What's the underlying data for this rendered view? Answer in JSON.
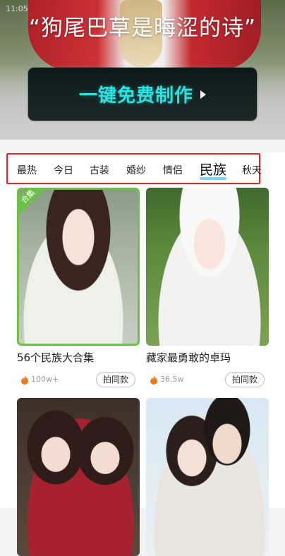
{
  "status": {
    "time": "11:05"
  },
  "hero": {
    "title": "“狗尾巴草是晦涩的诗”",
    "cta_label": "一键免费制作"
  },
  "tabs": {
    "items": [
      "最热",
      "今日",
      "古装",
      "婚纱",
      "情侣",
      "民族",
      "秋天"
    ],
    "active": "民族",
    "highlight_color": "#e0252b",
    "underline_color": "#7fd5f0"
  },
  "cards": [
    {
      "title": "56个民族大合集",
      "heat": "100w+",
      "action": "拍同款",
      "badge": "合集",
      "selected": true
    },
    {
      "title": "藏家最勇敢的卓玛",
      "heat": "36.5w",
      "action": "拍同款",
      "badge": "",
      "selected": false
    },
    {
      "title": "",
      "heat": "",
      "action": "",
      "badge": "",
      "selected": false
    },
    {
      "title": "",
      "heat": "",
      "action": "",
      "badge": "",
      "selected": false
    }
  ],
  "colors": {
    "cta_text": "#2de3e0",
    "badge_green": "#6cc04a",
    "flame": "#f07a1a"
  }
}
